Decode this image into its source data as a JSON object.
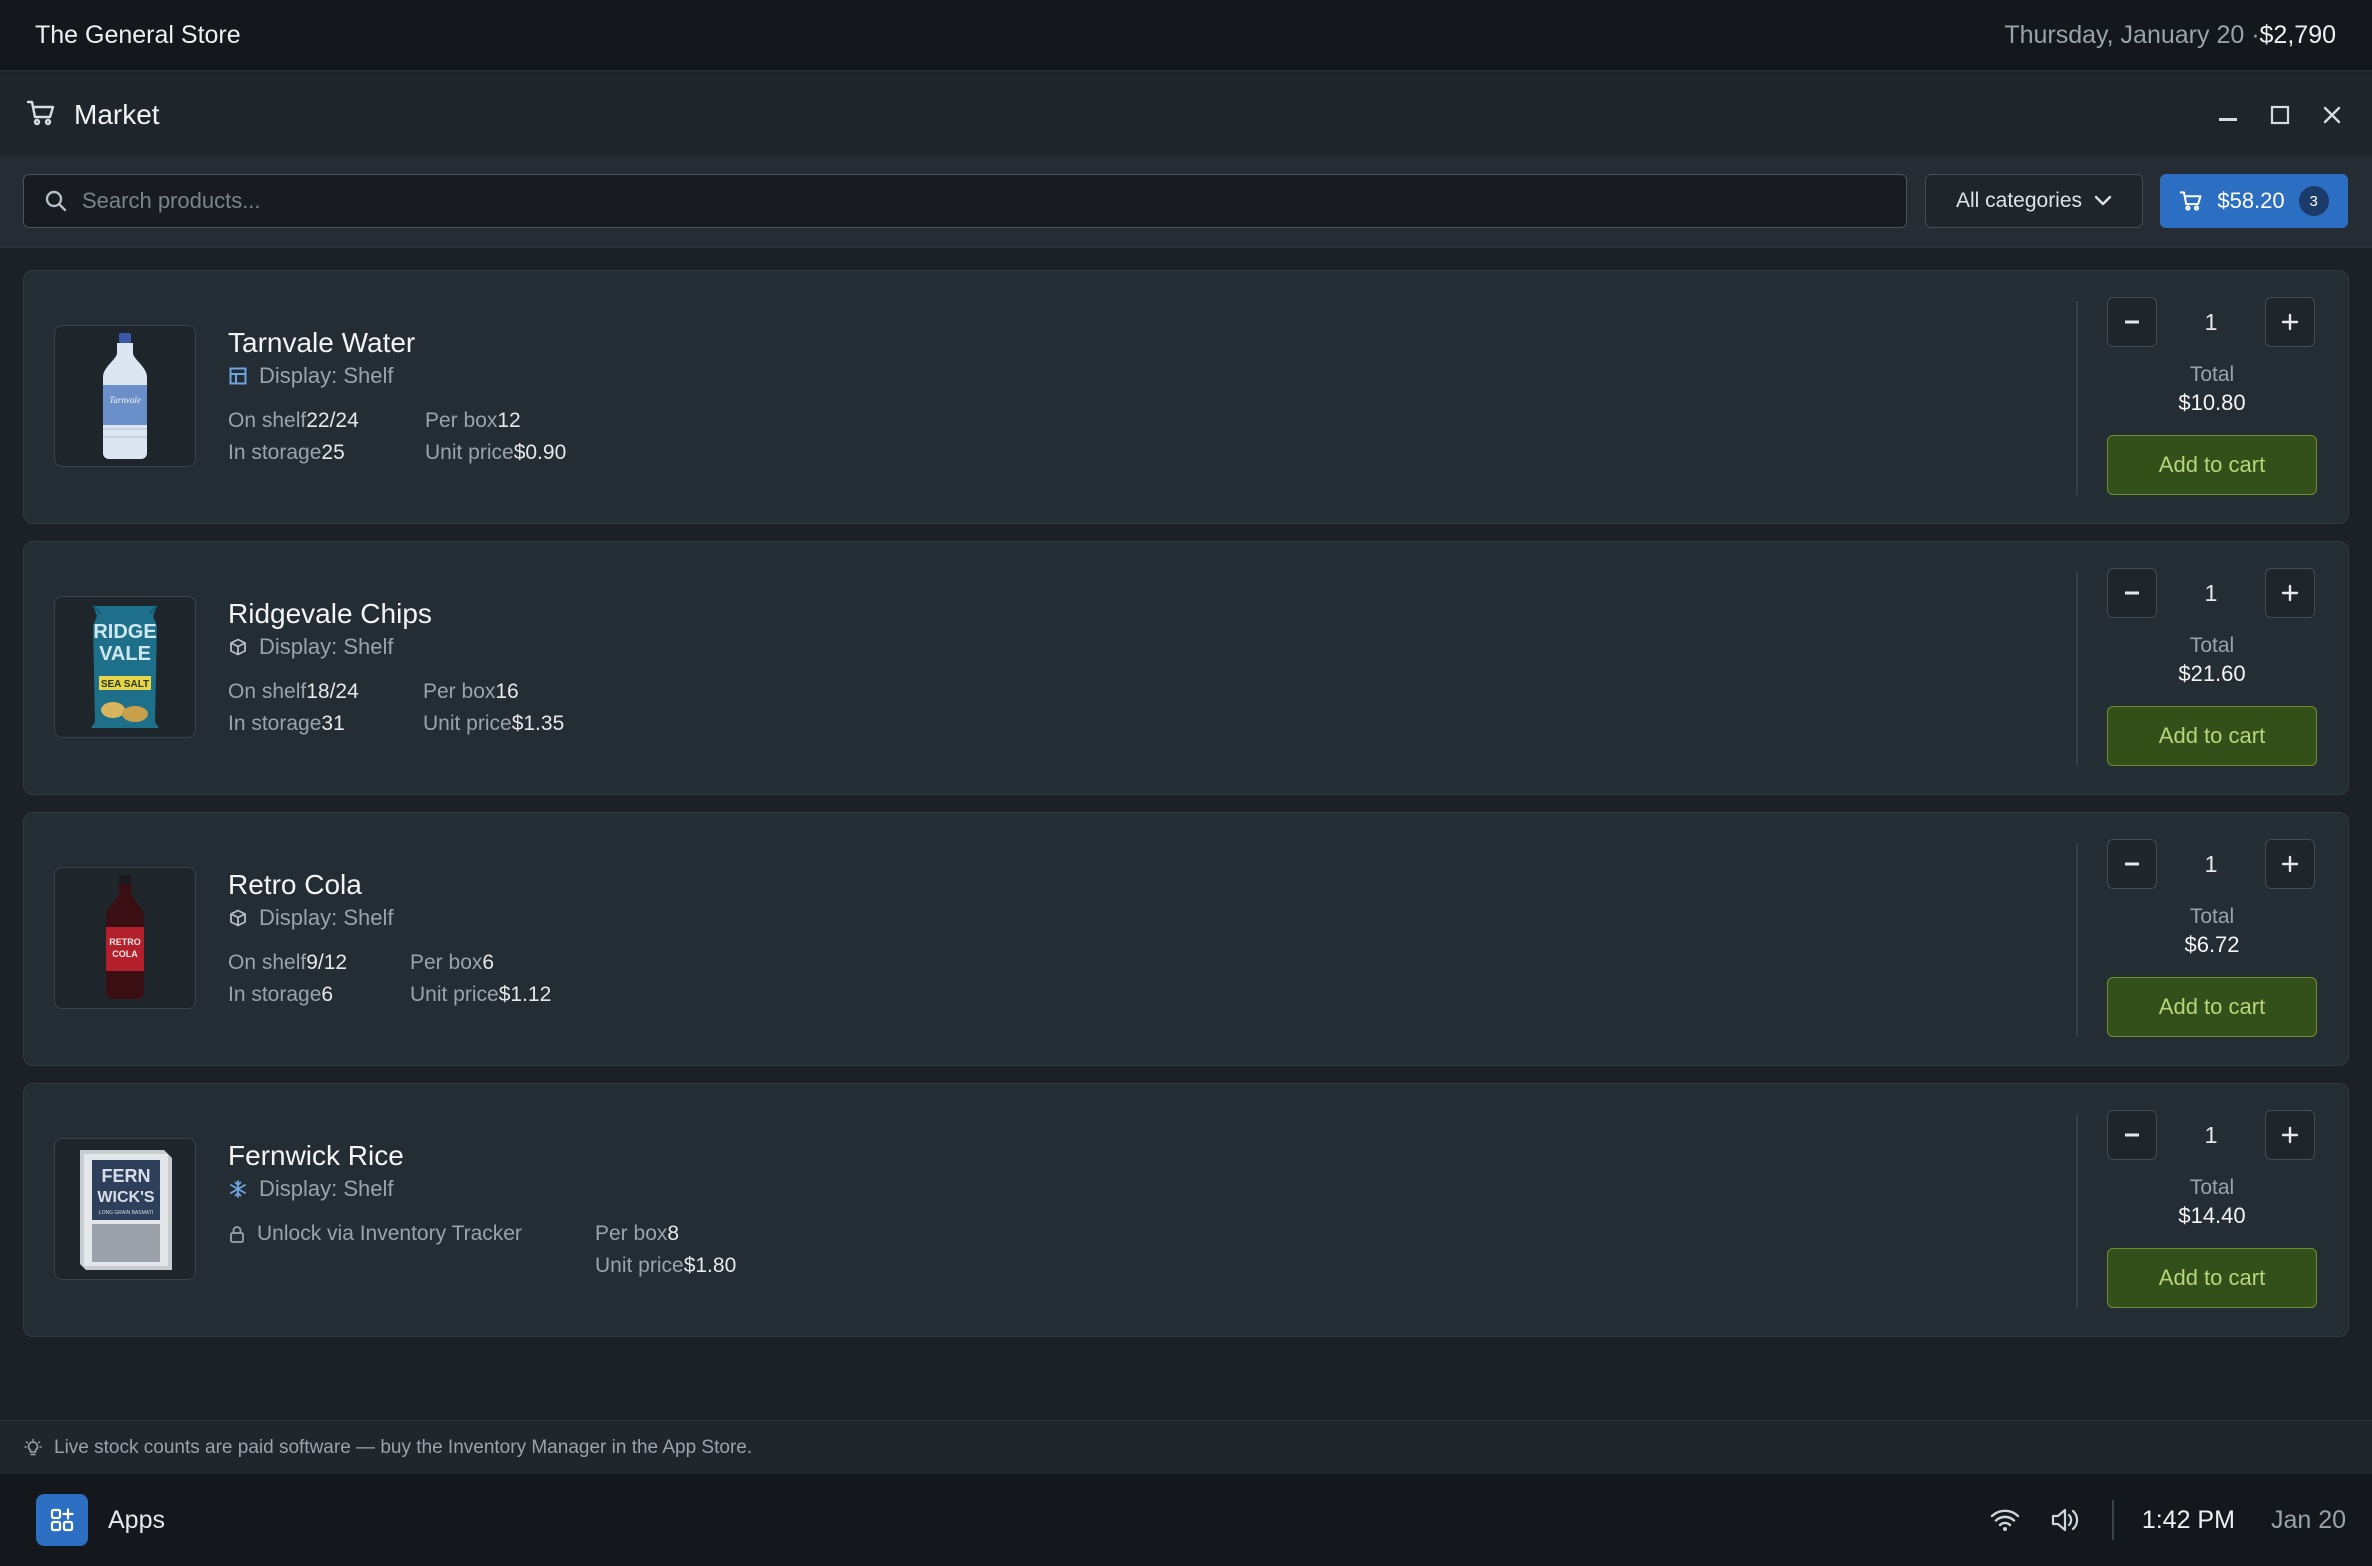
{
  "topbar": {
    "store_name": "The General Store",
    "date": "Thursday, January 20 ·",
    "balance": "$2,790"
  },
  "window": {
    "title": "Market",
    "icon": "cart-icon"
  },
  "toolbar": {
    "search_placeholder": "Search products...",
    "category_selected": "All categories",
    "cart_total": "$58.20",
    "cart_count": "3"
  },
  "products": [
    {
      "name": "Tarnvale Water",
      "display_icon": "shelf-icon",
      "display": "Display: Shelf",
      "on_shelf_label": "On shelf",
      "on_shelf": "22/24",
      "storage_label": "In storage",
      "storage": "25",
      "per_box_label": "Per box",
      "per_box": "12",
      "unit_price_label": "Unit price",
      "unit_price": "$0.90",
      "qty": "1",
      "total_label": "Total",
      "total": "$10.80",
      "add_label": "Add to cart"
    },
    {
      "name": "Ridgevale Chips",
      "display_icon": "box-icon",
      "display": "Display: Shelf",
      "on_shelf_label": "On shelf",
      "on_shelf": "18/24",
      "storage_label": "In storage",
      "storage": "31",
      "per_box_label": "Per box",
      "per_box": "16",
      "unit_price_label": "Unit price",
      "unit_price": "$1.35",
      "qty": "1",
      "total_label": "Total",
      "total": "$21.60",
      "add_label": "Add to cart"
    },
    {
      "name": "Retro Cola",
      "display_icon": "box-icon",
      "display": "Display: Shelf",
      "on_shelf_label": "On shelf",
      "on_shelf": "9/12",
      "storage_label": "In storage",
      "storage": "6",
      "per_box_label": "Per box",
      "per_box": "6",
      "unit_price_label": "Unit price",
      "unit_price": "$1.12",
      "qty": "1",
      "total_label": "Total",
      "total": "$6.72",
      "add_label": "Add to cart"
    },
    {
      "name": "Fernwick Rice",
      "display_icon": "snowflake-icon",
      "display": "Display: Shelf",
      "locked_text": "Unlock via Inventory Tracker",
      "per_box_label": "Per box",
      "per_box": "8",
      "unit_price_label": "Unit price",
      "unit_price": "$1.80",
      "qty": "1",
      "total_label": "Total",
      "total": "$14.40",
      "add_label": "Add to cart"
    }
  ],
  "product_images": {
    "water_label": "Tarnvale",
    "chips_text": [
      "RIDGE",
      "VALE",
      "SEA SALT"
    ],
    "cola_text": [
      "RETRO",
      "COLA"
    ],
    "rice_text": [
      "FERN",
      "WICK'S",
      "LONG GRAIN BASMATI"
    ]
  },
  "hint": "Live stock counts are paid software — buy the Inventory Manager in the App Store.",
  "taskbar": {
    "apps_label": "Apps",
    "time": "1:42 PM",
    "date": "Jan 20"
  },
  "colors": {
    "accent": "#2c6fc2",
    "add_button": "#34501a",
    "add_text": "#b9d57a",
    "bg": "#1c2127"
  }
}
